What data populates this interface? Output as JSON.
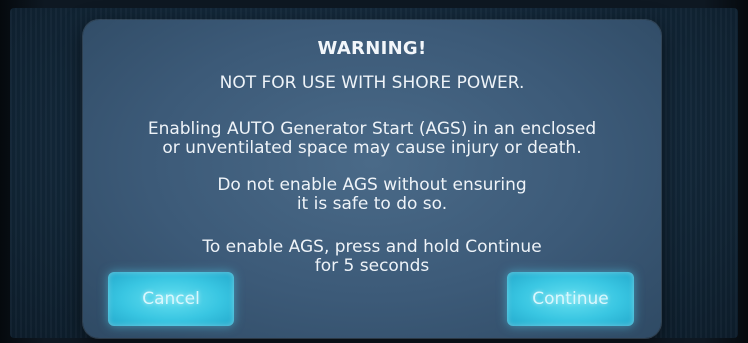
{
  "dialog": {
    "title": "WARNING!",
    "subtitle": "NOT FOR USE WITH SHORE POWER.",
    "paragraph1": {
      "line1": "Enabling AUTO Generator Start (AGS) in an enclosed",
      "line2": "or unventilated space may cause injury or death."
    },
    "paragraph2": {
      "line1": "Do not enable AGS without ensuring",
      "line2": "it is safe to do so."
    },
    "paragraph3": {
      "line1": "To enable AGS, press and hold Continue",
      "line2": "for 5 seconds"
    },
    "buttons": {
      "cancel_label": "Cancel",
      "continue_label": "Continue"
    }
  },
  "colors": {
    "dialog_bg": "#3c5a78",
    "button_accent": "#39c6e2",
    "text": "#eef3f8"
  }
}
